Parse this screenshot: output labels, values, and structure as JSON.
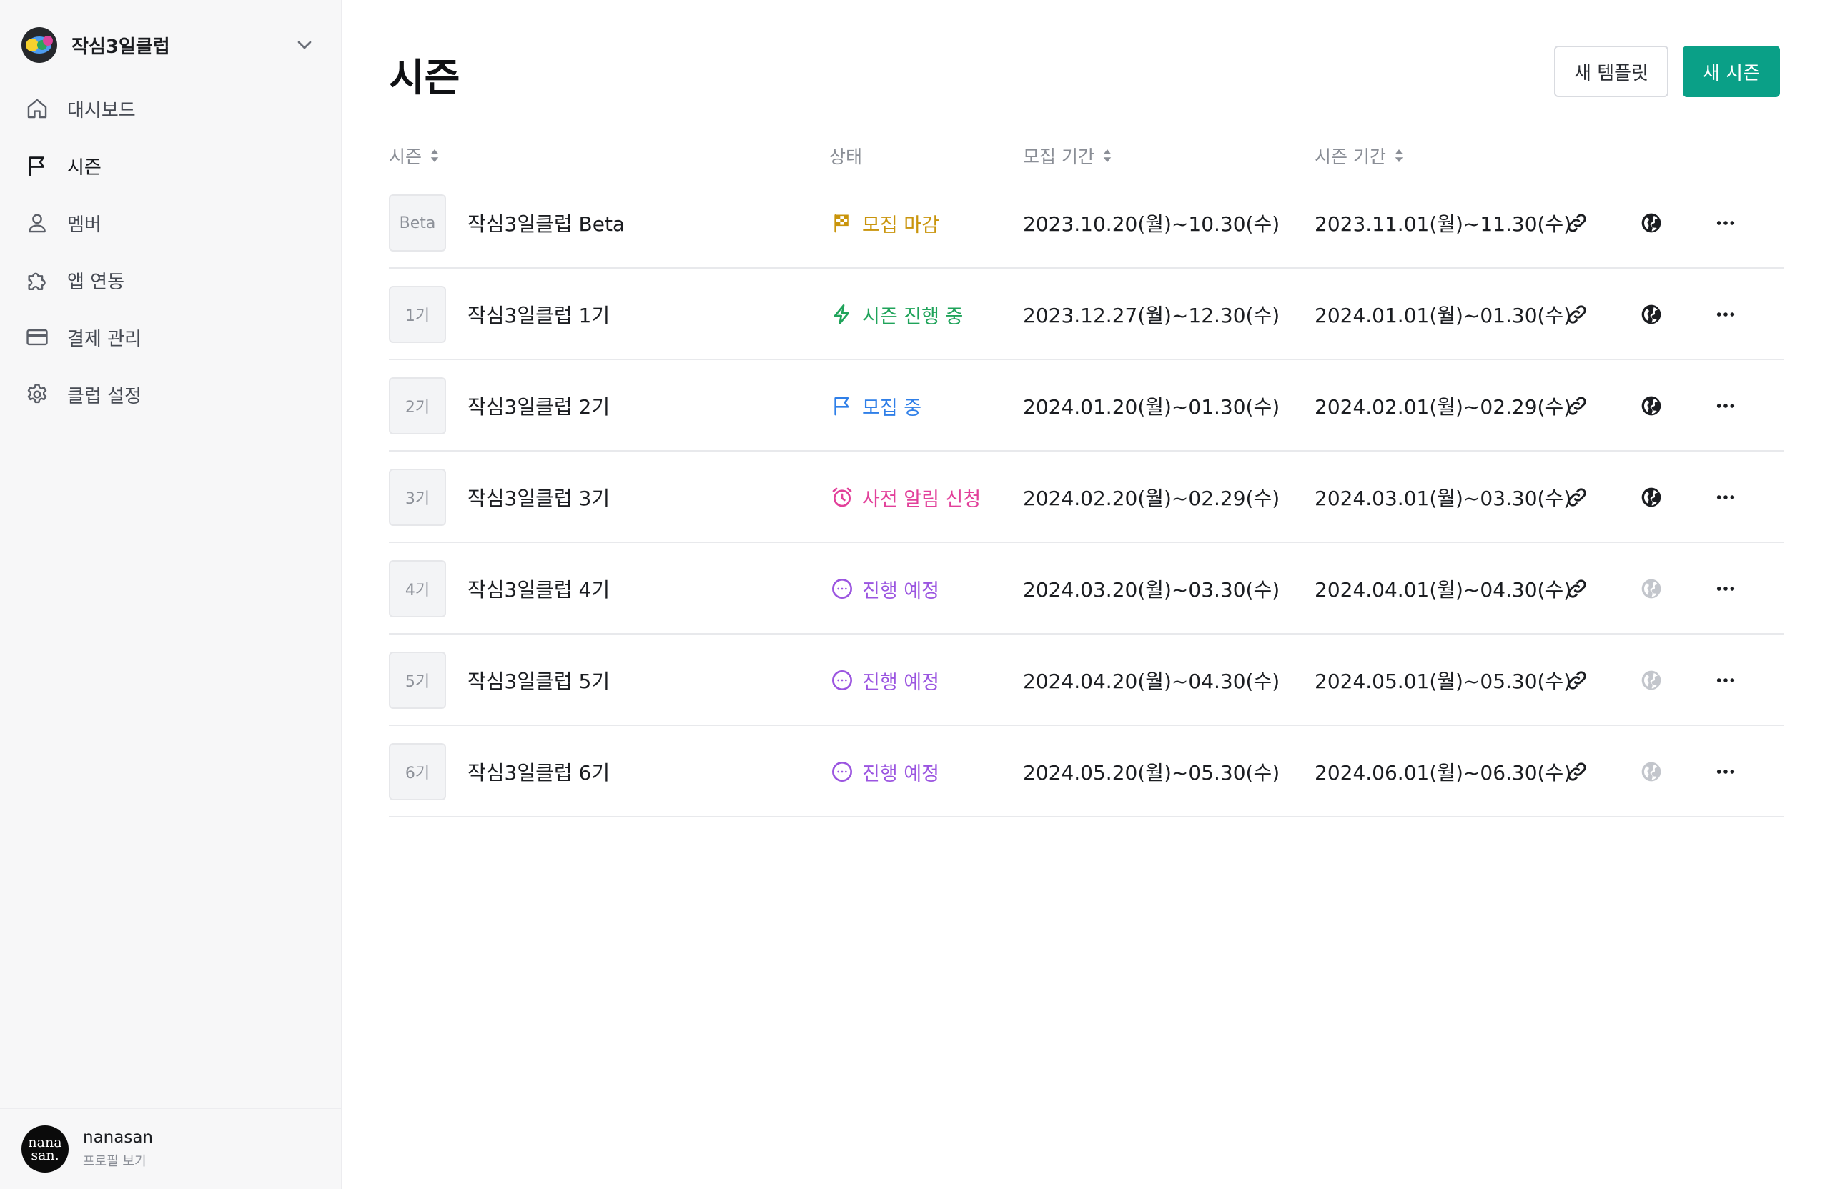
{
  "club": {
    "name": "작심3일클럽"
  },
  "nav": {
    "items": [
      {
        "label": "대시보드",
        "icon": "home-icon",
        "active": false
      },
      {
        "label": "시즌",
        "icon": "flag-icon",
        "active": true
      },
      {
        "label": "멤버",
        "icon": "user-icon",
        "active": false
      },
      {
        "label": "앱 연동",
        "icon": "puzzle-icon",
        "active": false
      },
      {
        "label": "결제 관리",
        "icon": "credit-card-icon",
        "active": false
      },
      {
        "label": "클럽 설정",
        "icon": "gear-icon",
        "active": false
      }
    ]
  },
  "profile": {
    "avatar_line1": "nana",
    "avatar_line2": "san.",
    "name": "nanasan",
    "link_label": "프로필 보기"
  },
  "page": {
    "title": "시즌",
    "template_button": "새 템플릿",
    "new_season_button": "새 시즌"
  },
  "table": {
    "headers": {
      "season": "시즌",
      "status": "상태",
      "recruit_period": "모집 기간",
      "season_period": "시즌 기간"
    },
    "rows": [
      {
        "thumb": "Beta",
        "name": "작심3일클럽 Beta",
        "status": "모집 마감",
        "status_icon": "checkered-flag-icon",
        "status_color": "#c9940b",
        "recruit": "2023.10.20(월)~10.30(수)",
        "period": "2023.11.01(월)~11.30(수)",
        "public": true
      },
      {
        "thumb": "1기",
        "name": "작심3일클럽 1기",
        "status": "시즌 진행 중",
        "status_icon": "lightning-icon",
        "status_color": "#1fa35a",
        "recruit": "2023.12.27(월)~12.30(수)",
        "period": "2024.01.01(월)~01.30(수)",
        "public": true
      },
      {
        "thumb": "2기",
        "name": "작심3일클럽 2기",
        "status": "모집 중",
        "status_icon": "flag-icon",
        "status_color": "#2f7fe8",
        "recruit": "2024.01.20(월)~01.30(수)",
        "period": "2024.02.01(월)~02.29(수)",
        "public": true
      },
      {
        "thumb": "3기",
        "name": "작심3일클럽 3기",
        "status": "사전 알림 신청",
        "status_icon": "alarm-clock-icon",
        "status_color": "#e2409a",
        "recruit": "2024.02.20(월)~02.29(수)",
        "period": "2024.03.01(월)~03.30(수)",
        "public": true
      },
      {
        "thumb": "4기",
        "name": "작심3일클럽 4기",
        "status": "진행 예정",
        "status_icon": "dots-circle-icon",
        "status_color": "#9b55e0",
        "recruit": "2024.03.20(월)~03.30(수)",
        "period": "2024.04.01(월)~04.30(수)",
        "public": false
      },
      {
        "thumb": "5기",
        "name": "작심3일클럽 5기",
        "status": "진행 예정",
        "status_icon": "dots-circle-icon",
        "status_color": "#9b55e0",
        "recruit": "2024.04.20(월)~04.30(수)",
        "period": "2024.05.01(월)~05.30(수)",
        "public": false
      },
      {
        "thumb": "6기",
        "name": "작심3일클럽 6기",
        "status": "진행 예정",
        "status_icon": "dots-circle-icon",
        "status_color": "#9b55e0",
        "recruit": "2024.05.20(월)~05.30(수)",
        "period": "2024.06.01(월)~06.30(수)",
        "public": false
      }
    ]
  },
  "colors": {
    "accent": "#0aa087",
    "globe_active": "#1b1d21",
    "globe_inactive": "#c3c6cc"
  }
}
